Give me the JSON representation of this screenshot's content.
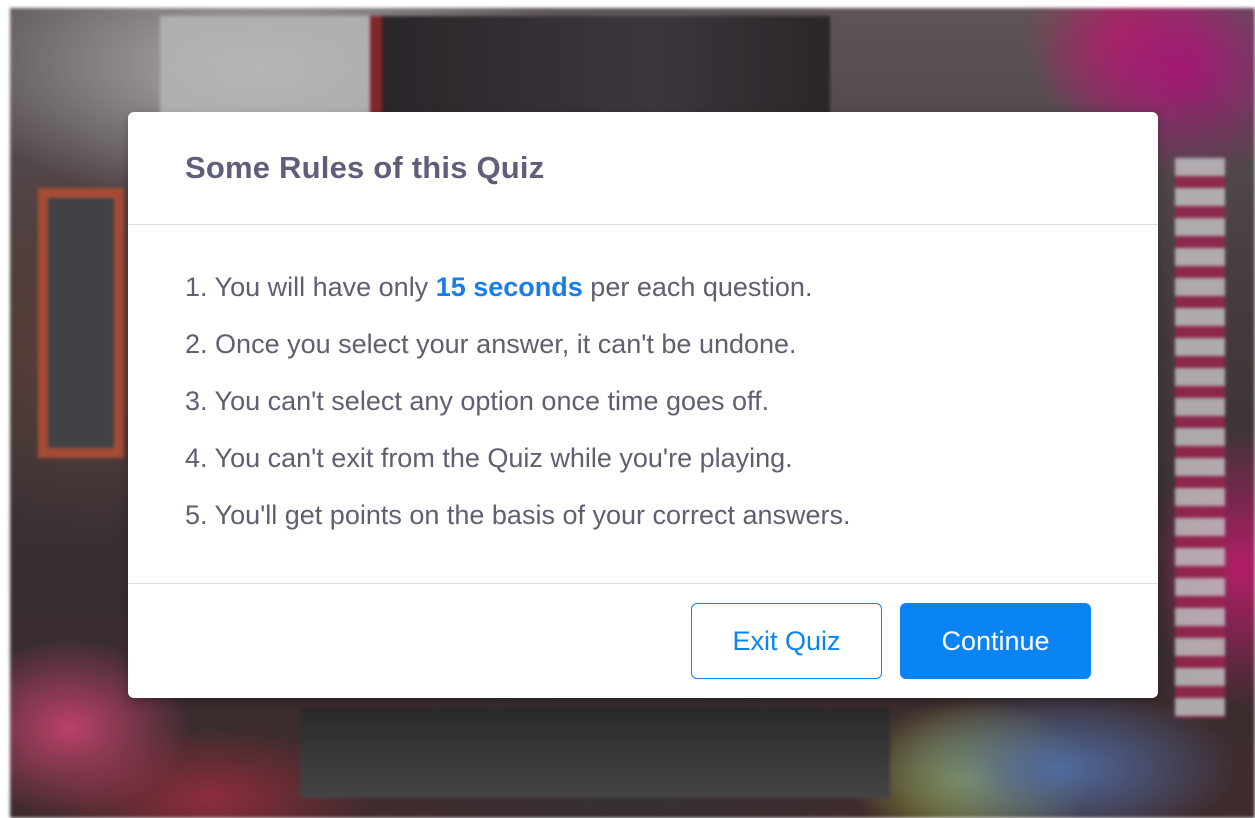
{
  "modal": {
    "title": "Some Rules of this Quiz",
    "rules": [
      {
        "number": "1.",
        "text_before": "You will have only",
        "highlight": "15 seconds",
        "text_after": "per each question."
      },
      {
        "number": "2.",
        "text": "Once you select your answer, it can't be undone."
      },
      {
        "number": "3.",
        "text": "You can't select any option once time goes off."
      },
      {
        "number": "4.",
        "text": "You can't exit from the Quiz while you're playing."
      },
      {
        "number": "5.",
        "text": "You'll get points on the basis of your correct answers."
      }
    ],
    "buttons": {
      "exit_label": "Exit Quiz",
      "continue_label": "Continue"
    }
  },
  "colors": {
    "accent": "#0a83f5",
    "highlight_text": "#1a7de6",
    "title_text": "#5f5f7a",
    "body_text": "#5e6070",
    "divider": "#dedede"
  }
}
